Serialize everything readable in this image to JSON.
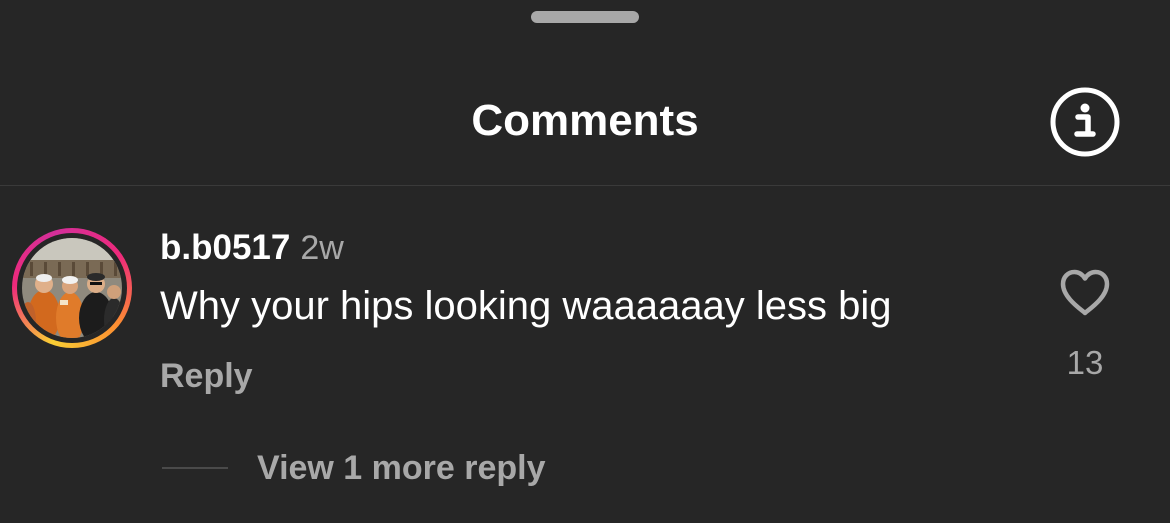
{
  "header": {
    "title": "Comments"
  },
  "comment": {
    "username": "b.b0517",
    "timestamp": "2w",
    "text": "Why your hips looking waaaaaay less big",
    "reply_label": "Reply",
    "like_count": "13",
    "view_replies_label": "View 1 more reply"
  },
  "icons": {
    "info": "info-icon",
    "like": "heart-outline-icon",
    "grabber": "sheet-grabber"
  },
  "colors": {
    "background": "#262626",
    "primary_text": "#ffffff",
    "secondary_text": "#a8a8a8",
    "story_ring_start": "#f9ce34",
    "story_ring_mid": "#ee2a7b",
    "story_ring_end": "#d42f9a"
  }
}
